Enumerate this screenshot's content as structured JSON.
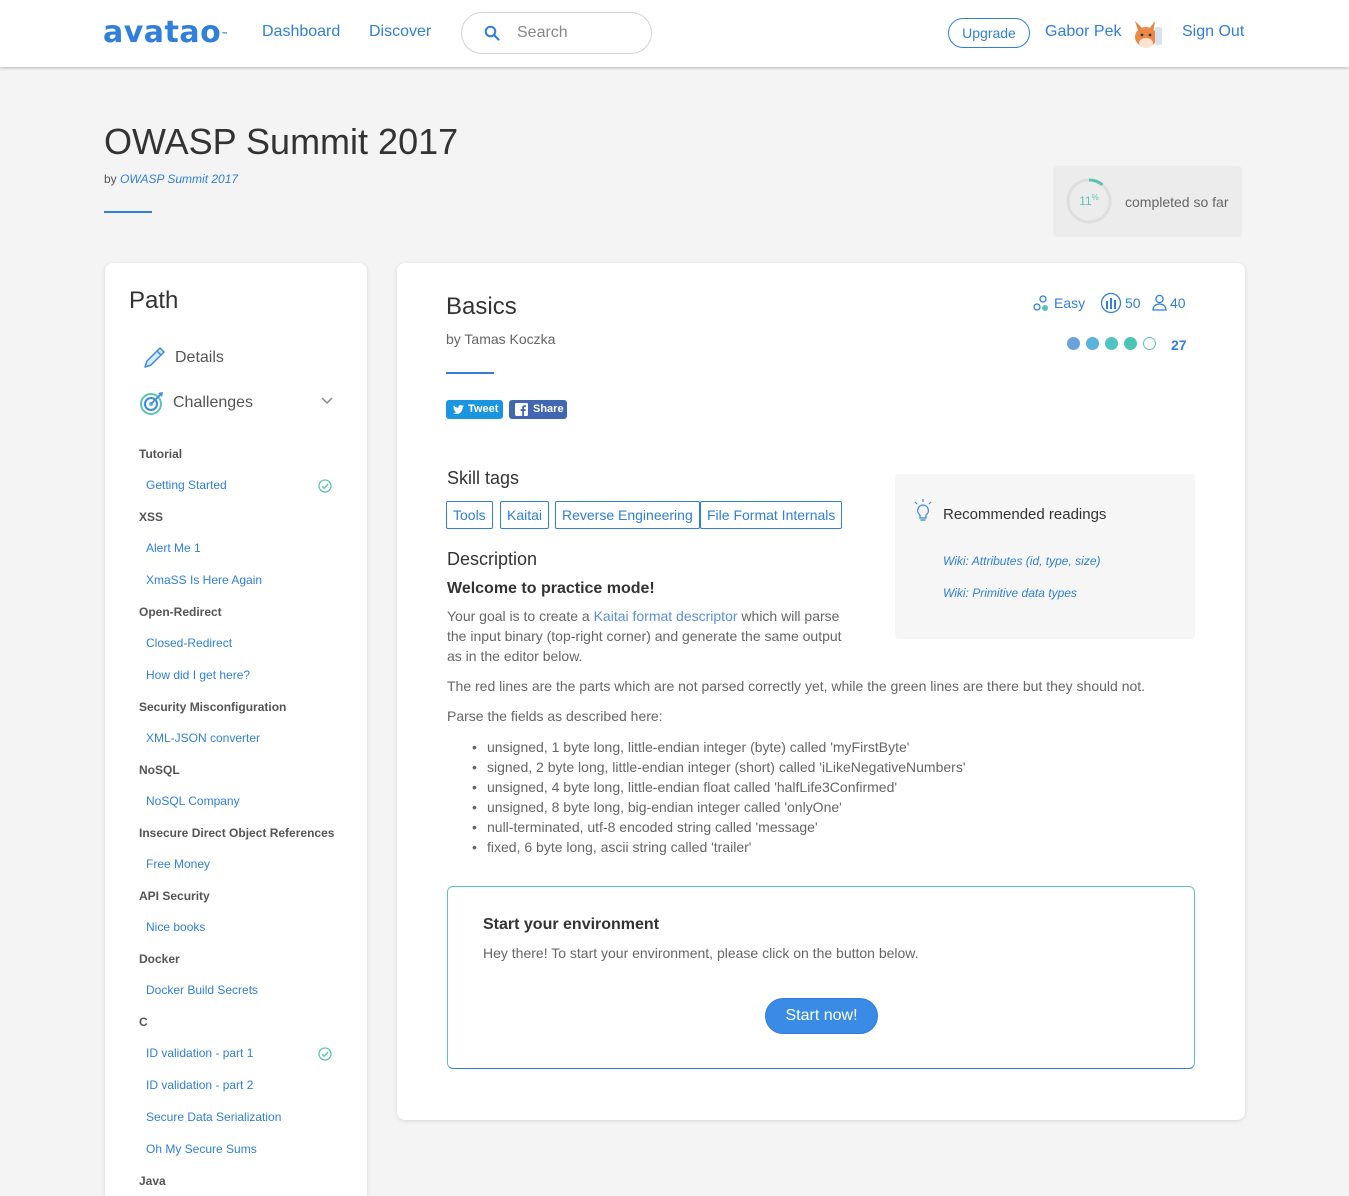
{
  "header": {
    "logo": "avatao",
    "logo_tm": "™",
    "nav": [
      "Dashboard",
      "Discover"
    ],
    "search_placeholder": "Search",
    "upgrade_label": "Upgrade",
    "user_name": "Gabor Pek",
    "sign_out": "Sign Out"
  },
  "page": {
    "title": "OWASP Summit 2017",
    "by_prefix": "by",
    "by_link": "OWASP Summit 2017",
    "progress_value": "11",
    "progress_unit": "%",
    "progress_fraction": 0.11,
    "progress_label": "completed so far"
  },
  "sidebar": {
    "title": "Path",
    "details_label": "Details",
    "challenges_label": "Challenges",
    "groups": [
      {
        "category": "Tutorial",
        "items": [
          {
            "label": "Getting Started",
            "done": true
          }
        ]
      },
      {
        "category": "XSS",
        "items": [
          {
            "label": "Alert Me 1",
            "done": false
          },
          {
            "label": "XmaSS Is Here Again",
            "done": false
          }
        ]
      },
      {
        "category": "Open-Redirect",
        "items": [
          {
            "label": "Closed-Redirect",
            "done": false
          },
          {
            "label": "How did I get here?",
            "done": false
          }
        ]
      },
      {
        "category": "Security Misconfiguration",
        "items": [
          {
            "label": "XML-JSON converter",
            "done": false
          }
        ]
      },
      {
        "category": "NoSQL",
        "items": [
          {
            "label": "NoSQL Company",
            "done": false
          }
        ]
      },
      {
        "category": "Insecure Direct Object References",
        "items": [
          {
            "label": "Free Money",
            "done": false
          }
        ]
      },
      {
        "category": "API Security",
        "items": [
          {
            "label": "Nice books",
            "done": false
          }
        ]
      },
      {
        "category": "Docker",
        "items": [
          {
            "label": "Docker Build Secrets",
            "done": false
          }
        ]
      },
      {
        "category": "C",
        "items": [
          {
            "label": "ID validation - part 1",
            "done": true
          },
          {
            "label": "ID validation - part 2",
            "done": false
          },
          {
            "label": "Secure Data Serialization",
            "done": false
          },
          {
            "label": "Oh My Secure Sums",
            "done": false
          }
        ]
      },
      {
        "category": "Java",
        "items": []
      }
    ]
  },
  "challenge": {
    "title": "Basics",
    "author": "by Tamas Koczka",
    "tweet_label": "Tweet",
    "share_label": "Share",
    "difficulty": "Easy",
    "points": "50",
    "solvers": "40",
    "rating_filled": 4,
    "rating_total": 5,
    "rating_count": "27",
    "skill_tags_heading": "Skill tags",
    "tags": [
      "Tools",
      "Kaitai",
      "Reverse Engineering",
      "File Format Internals"
    ],
    "description_heading": "Description",
    "welcome": "Welcome to practice mode!",
    "goal_prefix": "Your goal is to create a ",
    "goal_link": "Kaitai format descriptor",
    "goal_suffix": " which will parse the input binary (top-right corner) and generate the same output as in the editor below.",
    "red_lines": "The red lines are the parts which are not parsed correctly yet, while the green lines are there but they should not.",
    "parse_intro": "Parse the fields as described here:",
    "fields": [
      "unsigned, 1 byte long, little-endian integer (byte) called 'myFirstByte'",
      "signed, 2 byte long, little-endian integer (short) called 'iLikeNegativeNumbers'",
      "unsigned, 4 byte long, little-endian float called 'halfLife3Confirmed'",
      "unsigned, 8 byte long, big-endian integer called 'onlyOne'",
      "null-terminated, utf-8 encoded string called 'message'",
      "fixed, 6 byte long, ascii string called 'trailer'"
    ],
    "readings_title": "Recommended readings",
    "readings": [
      "Wiki: Attributes (id, type, size)",
      "Wiki: Primitive data types"
    ],
    "env_title": "Start your environment",
    "env_text": "Hey there! To start your environment, please click on the button below.",
    "start_label": "Start now!"
  },
  "colors": {
    "brand": "#2f7fdb",
    "success": "#5cc4b3",
    "rating_dots": [
      "#6aa3dc",
      "#58b4d8",
      "#4fc3c6",
      "#4cc4b8"
    ]
  }
}
